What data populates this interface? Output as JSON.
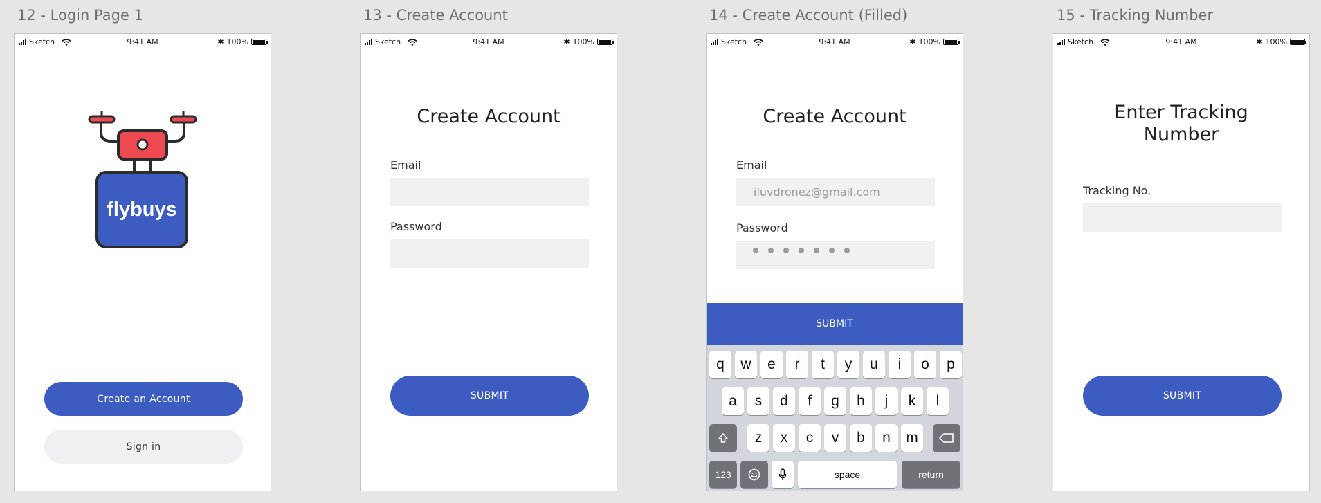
{
  "artboards": [
    {
      "title": "12 - Login Page 1"
    },
    {
      "title": "13 - Create Account"
    },
    {
      "title": "14 - Create Account (Filled)"
    },
    {
      "title": "15 - Tracking Number"
    }
  ],
  "status_bar": {
    "carrier": "Sketch",
    "time": "9:41 AM",
    "battery": "100%"
  },
  "login": {
    "logo_text": "flybuys",
    "create_account_label": "Create an Account",
    "sign_in_label": "Sign in",
    "colors": {
      "brand": "#3c5cc2",
      "drone_red": "#ef4a52",
      "outline": "#2b2b2b"
    }
  },
  "create_account": {
    "title": "Create Account",
    "email_label": "Email",
    "password_label": "Password",
    "submit_label": "SUBMIT"
  },
  "create_account_filled": {
    "title": "Create Account",
    "email_label": "Email",
    "email_value": "iluvdronez@gmail.com",
    "password_label": "Password",
    "password_dots": 7,
    "submit_label": "SUBMIT",
    "keyboard": {
      "row1": [
        "q",
        "w",
        "e",
        "r",
        "t",
        "y",
        "u",
        "i",
        "o",
        "p"
      ],
      "row2": [
        "a",
        "s",
        "d",
        "f",
        "g",
        "h",
        "j",
        "k",
        "l"
      ],
      "row3": [
        "z",
        "x",
        "c",
        "v",
        "b",
        "n",
        "m"
      ],
      "numbers_label": "123",
      "space_label": "space",
      "return_label": "return"
    }
  },
  "tracking": {
    "title_line1": "Enter Tracking",
    "title_line2": "Number",
    "tracking_label": "Tracking No.",
    "submit_label": "SUBMIT"
  }
}
